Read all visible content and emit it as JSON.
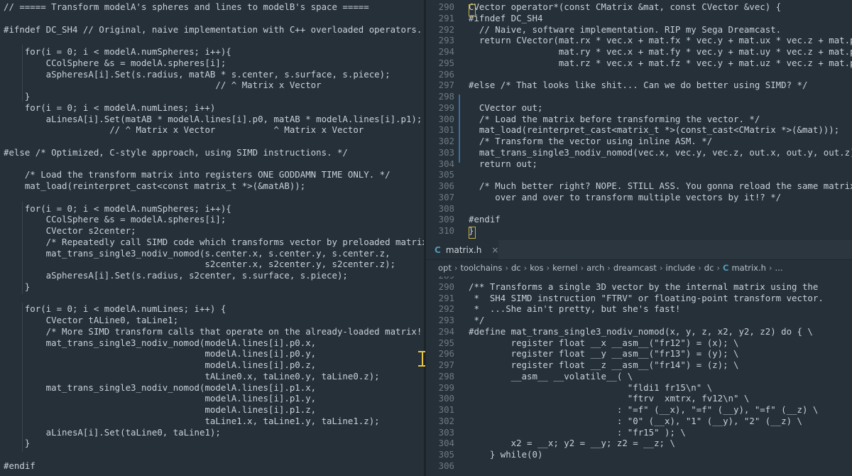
{
  "left_pane": {
    "lines": [
      "// ===== Transform modelA's spheres and lines to modelB's space =====",
      "",
      "#ifndef DC_SH4 // Original, naive implementation with C++ overloaded operators.",
      "",
      "    for(i = 0; i < modelA.numSpheres; i++){",
      "        CColSphere &s = modelA.spheres[i];",
      "        aSpheresA[i].Set(s.radius, matAB * s.center, s.surface, s.piece);",
      "                                        // ^ Matrix x Vector",
      "    }",
      "    for(i = 0; i < modelA.numLines; i++)",
      "        aLinesA[i].Set(matAB * modelA.lines[i].p0, matAB * modelA.lines[i].p1);",
      "                    // ^ Matrix x Vector           ^ Matrix x Vector",
      "",
      "#else /* Optimized, C-style approach, using SIMD instructions. */",
      "",
      "    /* Load the transform matrix into registers ONE GODDAMN TIME ONLY. */",
      "    mat_load(reinterpret_cast<const matrix_t *>(&matAB));",
      "",
      "    for(i = 0; i < modelA.numSpheres; i++){",
      "        CColSphere &s = modelA.spheres[i];",
      "        CVector s2center;",
      "        /* Repeatedly call SIMD code which transforms vector by preloaded matrix. */",
      "        mat_trans_single3_nodiv_nomod(s.center.x, s.center.y, s.center.z,",
      "                                      s2center.x, s2center.y, s2center.z);",
      "        aSpheresA[i].Set(s.radius, s2center, s.surface, s.piece);",
      "    }",
      "",
      "    for(i = 0; i < modelA.numLines; i++) {",
      "        CVector tALine0, taLine1;",
      "        /* More SIMD transform calls that operate on the already-loaded matrix! */",
      "        mat_trans_single3_nodiv_nomod(modelA.lines[i].p0.x,",
      "                                      modelA.lines[i].p0.y,",
      "                                      modelA.lines[i].p0.z,",
      "                                      tALine0.x, taLine0.y, taLine0.z);",
      "        mat_trans_single3_nodiv_nomod(modelA.lines[i].p1.x,",
      "                                      modelA.lines[i].p1.y,",
      "                                      modelA.lines[i].p1.z,",
      "                                      taLine1.x, taLine1.y, taLine1.z);",
      "        aLinesA[i].Set(taLine0, taLine1);",
      "    }",
      "",
      "#endif"
    ]
  },
  "right_top": {
    "line_numbers": [
      "290",
      "291",
      "292",
      "293",
      "294",
      "295",
      "296",
      "297",
      "298",
      "299",
      "300",
      "301",
      "302",
      "303",
      "304",
      "305",
      "306",
      "307",
      "308",
      "309",
      "310"
    ],
    "lines": [
      "CVector operator*(const CMatrix &mat, const CVector &vec) {",
      "#ifndef DC_SH4",
      "  // Naive, software implementation. RIP my Sega Dreamcast.",
      "  return CVector(mat.rx * vec.x + mat.fx * vec.y + mat.ux * vec.z + mat.px,",
      "                 mat.ry * vec.x + mat.fy * vec.y + mat.uy * vec.z + mat.py,",
      "                 mat.rz * vec.x + mat.fz * vec.y + mat.uz * vec.z + mat.pz);",
      "",
      "#else /* That looks like shit... Can we do better using SIMD? */",
      "",
      "  CVector out;",
      "  /* Load the matrix before transforming the vector. */",
      "  mat_load(reinterpret_cast<matrix_t *>(const_cast<CMatrix *>(&mat)));",
      "  /* Transform the vector using inline ASM. */",
      "  mat_trans_single3_nodiv_nomod(vec.x, vec.y, vec.z, out.x, out.y, out.z);",
      "  return out;",
      "",
      "  /* Much better right? NOPE. STILL ASS. You gonna reload the same matrix",
      "     over and over to transform multiple vectors by it!? */",
      "",
      "#endif",
      "}"
    ]
  },
  "tab": {
    "icon": "C",
    "label": "matrix.h",
    "close": "×"
  },
  "breadcrumbs": [
    "opt",
    "toolchains",
    "dc",
    "kos",
    "kernel",
    "arch",
    "dreamcast",
    "include",
    "dc",
    "matrix.h",
    "..."
  ],
  "breadcrumb_file_icon": "C",
  "right_bottom": {
    "line_numbers": [
      "289",
      "290",
      "291",
      "292",
      "293",
      "294",
      "295",
      "296",
      "297",
      "298",
      "299",
      "300",
      "301",
      "302",
      "303",
      "304",
      "305",
      "306"
    ],
    "lines": [
      "",
      "/** Transforms a single 3D vector by the internal matrix using the",
      " *  SH4 SIMD instruction \"FTRV\" or floating-point transform vector.",
      " *  ...She ain't pretty, but she's fast!",
      " */",
      "#define mat_trans_single3_nodiv_nomod(x, y, z, x2, y2, z2) do { \\",
      "        register float __x __asm__(\"fr12\") = (x); \\",
      "        register float __y __asm__(\"fr13\") = (y); \\",
      "        register float __z __asm__(\"fr14\") = (z); \\",
      "        __asm__ __volatile__( \\",
      "                              \"fldi1 fr15\\n\" \\",
      "                              \"ftrv  xmtrx, fv12\\n\" \\",
      "                            : \"=f\" (__x), \"=f\" (__y), \"=f\" (__z) \\",
      "                            : \"0\" (__x), \"1\" (__y), \"2\" (__z) \\",
      "                            : \"fr15\" ); \\",
      "        x2 = __x; y2 = __y; z2 = __z; \\",
      "    } while(0)",
      ""
    ]
  }
}
